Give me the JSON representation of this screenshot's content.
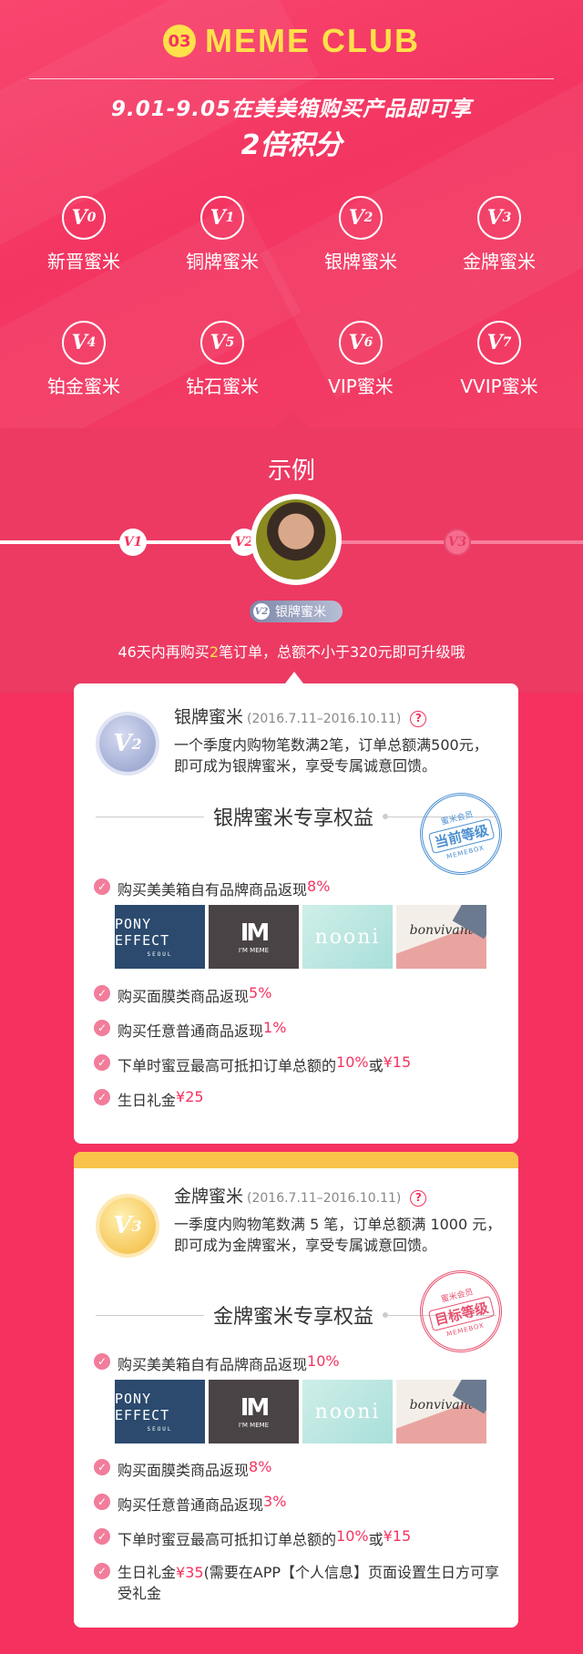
{
  "header": {
    "number": "03",
    "title": "MEME CLUB",
    "promo_line1": "9.01-9.05在美美箱购买产品即可享",
    "promo_line2": "2倍积分"
  },
  "levels": [
    {
      "badge": "V",
      "sub": "0",
      "name": "新晋蜜米"
    },
    {
      "badge": "V",
      "sub": "1",
      "name": "铜牌蜜米"
    },
    {
      "badge": "V",
      "sub": "2",
      "name": "银牌蜜米"
    },
    {
      "badge": "V",
      "sub": "3",
      "name": "金牌蜜米"
    },
    {
      "badge": "V",
      "sub": "4",
      "name": "铂金蜜米"
    },
    {
      "badge": "V",
      "sub": "5",
      "name": "钻石蜜米"
    },
    {
      "badge": "V",
      "sub": "6",
      "name": "VIP蜜米"
    },
    {
      "badge": "V",
      "sub": "7",
      "name": "VVIP蜜米"
    }
  ],
  "example": {
    "title": "示例",
    "node_left": "V1",
    "node_current": "V2",
    "node_right": "V3",
    "tag_badge": "V2",
    "tag_label": "银牌蜜米",
    "tip_before": "46天内再购买",
    "tip_count": "2",
    "tip_after": "笔订单，总额不小于320元即可升级哦"
  },
  "card_silver": {
    "medal": "V",
    "medal_sub": "2",
    "name": "银牌蜜米",
    "period": "(2016.7.11–2016.10.11)",
    "help": "?",
    "desc": "一个季度内购物笔数满2笔，订单总额满500元，即可成为银牌蜜米，享受专属诚意回馈。",
    "section": "银牌蜜米专享权益",
    "stamp_top": "蜜米会员",
    "stamp_main": "当前等级",
    "stamp_bottom": "MEMEBOX",
    "benefit1_text": "购买美美箱自有品牌商品返现",
    "benefit1_value": "8%",
    "benefit2_text": "购买面膜类商品返现",
    "benefit2_value": "5%",
    "benefit3_text": "购买任意普通商品返现",
    "benefit3_value": "1%",
    "benefit4_text": "下单时蜜豆最高可抵扣订单总额的",
    "benefit4_value": "10%",
    "benefit4_or": "或",
    "benefit4_cap": "¥15",
    "benefit5_text": "生日礼金",
    "benefit5_value": "¥25"
  },
  "card_gold": {
    "medal": "V",
    "medal_sub": "3",
    "name": "金牌蜜米",
    "period": "(2016.7.11–2016.10.11)",
    "help": "?",
    "desc": "一季度内购物笔数满 5 笔，订单总额满 1000 元，即可成为金牌蜜米，享受专属诚意回馈。",
    "section": "金牌蜜米专享权益",
    "stamp_top": "蜜米会员",
    "stamp_main": "目标等级",
    "stamp_bottom": "MEMEBOX",
    "benefit1_text": "购买美美箱自有品牌商品返现",
    "benefit1_value": "10%",
    "benefit2_text": "购买面膜类商品返现",
    "benefit2_value": "8%",
    "benefit3_text": "购买任意普通商品返现",
    "benefit3_value": "3%",
    "benefit4_text": "下单时蜜豆最高可抵扣订单总额的",
    "benefit4_value": "10%",
    "benefit4_or": "或",
    "benefit4_cap": "¥15",
    "benefit5_text": "生日礼金",
    "benefit5_value": "¥35",
    "benefit5_note": "(需要在APP【个人信息】页面设置生日方可享受礼金"
  },
  "brands": {
    "pony": "PONY EFFECT",
    "pony_sub": "SEOUL",
    "meme_logo": "IM",
    "meme_text": "I'M MEME",
    "nooni": "nooni",
    "bonvivant": "bonvivant"
  },
  "colors": {
    "background": "#f5325f",
    "accent_yellow": "#ffe14a",
    "highlight": "#f5325f",
    "gold_bar": "#f8c24b"
  }
}
